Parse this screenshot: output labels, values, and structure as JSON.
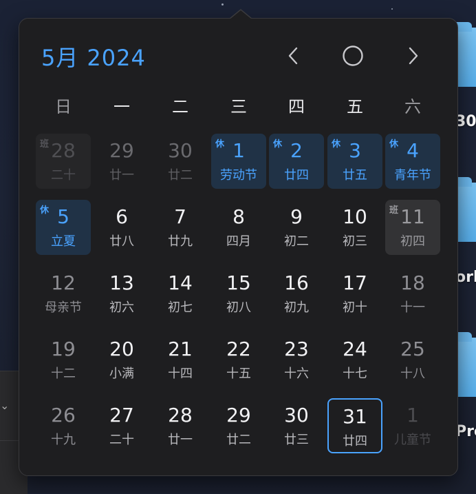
{
  "header": {
    "month": "5月",
    "year": "2024"
  },
  "weekdays": [
    "日",
    "一",
    "二",
    "三",
    "四",
    "五",
    "六"
  ],
  "badges": {
    "holiday": "休",
    "work": "班"
  },
  "desktop": {
    "labels": [
      "30",
      "ork",
      "Pro"
    ]
  },
  "weeks": [
    [
      {
        "num": "28",
        "sub": "二十",
        "type": "work-faded",
        "badge": "班"
      },
      {
        "num": "29",
        "sub": "廿一",
        "type": "other"
      },
      {
        "num": "30",
        "sub": "廿二",
        "type": "other"
      },
      {
        "num": "1",
        "sub": "劳动节",
        "type": "holiday",
        "badge": "休"
      },
      {
        "num": "2",
        "sub": "廿四",
        "type": "holiday",
        "badge": "休"
      },
      {
        "num": "3",
        "sub": "廿五",
        "type": "holiday",
        "badge": "休"
      },
      {
        "num": "4",
        "sub": "青年节",
        "type": "holiday",
        "badge": "休"
      }
    ],
    [
      {
        "num": "5",
        "sub": "立夏",
        "type": "holiday",
        "badge": "休"
      },
      {
        "num": "6",
        "sub": "廿八",
        "type": "normal"
      },
      {
        "num": "7",
        "sub": "廿九",
        "type": "normal"
      },
      {
        "num": "8",
        "sub": "四月",
        "type": "normal"
      },
      {
        "num": "9",
        "sub": "初二",
        "type": "normal"
      },
      {
        "num": "10",
        "sub": "初三",
        "type": "normal"
      },
      {
        "num": "11",
        "sub": "初四",
        "type": "work",
        "badge": "班"
      }
    ],
    [
      {
        "num": "12",
        "sub": "母亲节",
        "type": "weekend"
      },
      {
        "num": "13",
        "sub": "初六",
        "type": "normal"
      },
      {
        "num": "14",
        "sub": "初七",
        "type": "normal"
      },
      {
        "num": "15",
        "sub": "初八",
        "type": "normal"
      },
      {
        "num": "16",
        "sub": "初九",
        "type": "normal"
      },
      {
        "num": "17",
        "sub": "初十",
        "type": "normal"
      },
      {
        "num": "18",
        "sub": "十一",
        "type": "weekend"
      }
    ],
    [
      {
        "num": "19",
        "sub": "十二",
        "type": "weekend"
      },
      {
        "num": "20",
        "sub": "小满",
        "type": "normal"
      },
      {
        "num": "21",
        "sub": "十四",
        "type": "normal"
      },
      {
        "num": "22",
        "sub": "十五",
        "type": "normal"
      },
      {
        "num": "23",
        "sub": "十六",
        "type": "normal"
      },
      {
        "num": "24",
        "sub": "十七",
        "type": "normal"
      },
      {
        "num": "25",
        "sub": "十八",
        "type": "weekend"
      }
    ],
    [
      {
        "num": "26",
        "sub": "十九",
        "type": "weekend"
      },
      {
        "num": "27",
        "sub": "二十",
        "type": "normal"
      },
      {
        "num": "28",
        "sub": "廿一",
        "type": "normal"
      },
      {
        "num": "29",
        "sub": "廿二",
        "type": "normal"
      },
      {
        "num": "30",
        "sub": "廿三",
        "type": "normal"
      },
      {
        "num": "31",
        "sub": "廿四",
        "type": "today"
      },
      {
        "num": "1",
        "sub": "儿童节",
        "type": "other-dim"
      }
    ]
  ],
  "colors": {
    "accent": "#4aa3ff",
    "holiday_bg": "#203246",
    "work_bg": "#333335",
    "panel": "#1e1e20"
  }
}
